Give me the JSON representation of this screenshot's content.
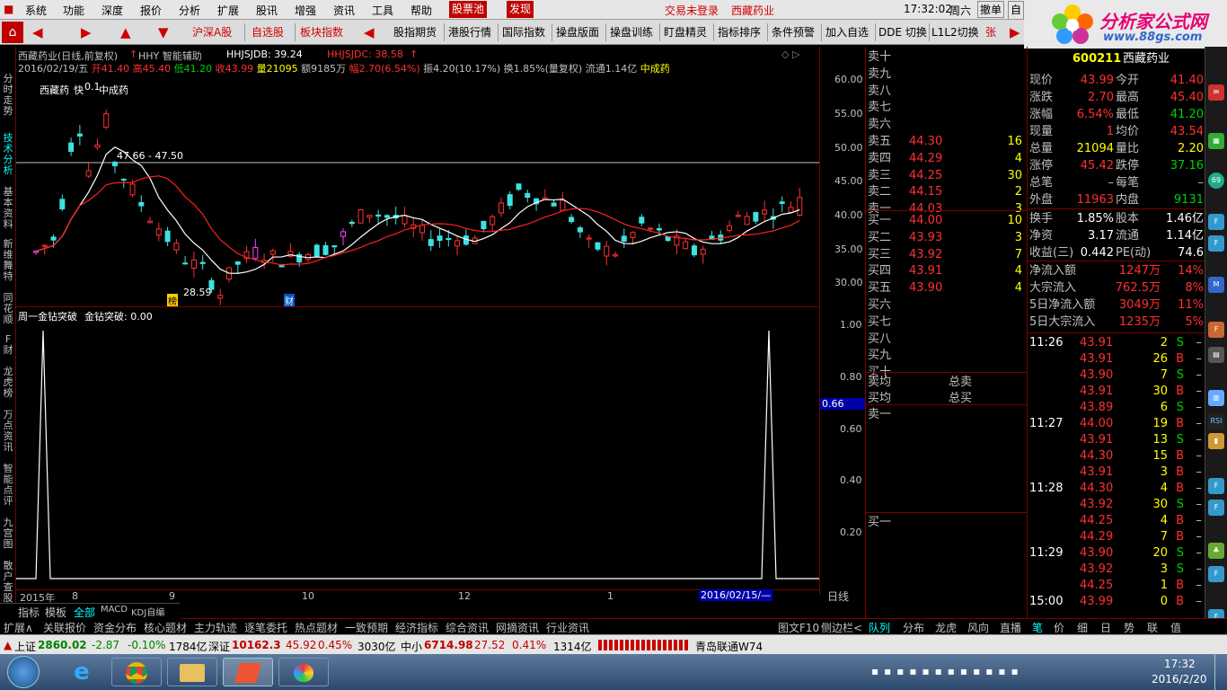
{
  "menu": {
    "items": [
      "系统",
      "功能",
      "深度",
      "报价",
      "分析",
      "扩展",
      "股讯",
      "增强",
      "资讯",
      "工具",
      "帮助"
    ],
    "gupiaochi": "股票池",
    "faxian": "发现",
    "login": "交易未登录",
    "stock": "西藏药业"
  },
  "topright": {
    "time": "17:32:02",
    "weekday": "周六",
    "cancel": "撤单",
    "select": "自选"
  },
  "toolbar": {
    "items": [
      "沪深A股",
      "自选股",
      "板块指数",
      "股指期货",
      "港股行情",
      "国际指数",
      "操盘版面",
      "操盘训练",
      "盯盘精灵",
      "指标排序",
      "条件预警",
      "加入自选",
      "DDE 切换",
      "L1L2切换",
      "张"
    ]
  },
  "logo": {
    "text": "分析家公式网",
    "url": "www.88gs.com"
  },
  "leftbar": {
    "tabs": [
      "分时走势",
      "技术分析",
      "基本资料",
      "新维舞特",
      "同花顺",
      "F财",
      "龙虎榜",
      "万点资讯",
      "智能点评",
      "九宫图",
      "散户查股"
    ]
  },
  "chart": {
    "title": "西藏药业(日线,前复权)",
    "hhy": "HHY 智能辅助",
    "hhjsjdb": "HHJSJDB: 39.24",
    "hhjsjdc": "HHJSJDC: 38.58",
    "date": "2016/02/19/五",
    "open": "开41.40",
    "high": "高45.40",
    "low": "低41.20",
    "close": "收43.99",
    "vol": "量21095",
    "amt": "额9185万",
    "range": "幅2.70(6.54%)",
    "amp": "振4.20(10.17%)",
    "turn": "换1.85%(量复权)",
    "float": "流通1.14亿",
    "concept": "中成药",
    "label_stock": "西藏药",
    "label_kuai": "快",
    "label_val": "0.1",
    "label_zcy": "中成药",
    "range_label": "47.66 - 47.50",
    "low_label": "28.59",
    "bang": "榜",
    "cai": "财",
    "nav_hint": "◇ ▷"
  },
  "price_axis": [
    "60.00",
    "55.00",
    "50.00",
    "45.00",
    "40.00",
    "35.00",
    "30.00"
  ],
  "indicator": {
    "title": "周一金钻突破",
    "value": "金钻突破: 0.00",
    "axis": [
      "1.00",
      "0.80",
      "0.66",
      "0.60",
      "0.40",
      "0.20"
    ]
  },
  "xaxis": {
    "labels": [
      "2015年",
      "8",
      "9",
      "10",
      "12",
      "1"
    ],
    "cursor": "2016/02/15/—",
    "period": "日线"
  },
  "chart_data": {
    "type": "candlestick",
    "title": "西藏药业(日线,前复权)",
    "ylim": [
      28,
      62
    ],
    "last": {
      "date": "2016/02/19",
      "open": 41.4,
      "high": 45.4,
      "low": 41.2,
      "close": 43.99
    },
    "annotations": [
      "47.66 - 47.50",
      "28.59"
    ]
  },
  "book": {
    "sell": [
      [
        "卖十",
        "",
        ""
      ],
      [
        "卖九",
        "",
        ""
      ],
      [
        "卖八",
        "",
        ""
      ],
      [
        "卖七",
        "",
        ""
      ],
      [
        "卖六",
        "",
        ""
      ],
      [
        "卖五",
        "44.30",
        "16"
      ],
      [
        "卖四",
        "44.29",
        "4"
      ],
      [
        "卖三",
        "44.25",
        "30"
      ],
      [
        "卖二",
        "44.15",
        "2"
      ],
      [
        "卖一",
        "44.03",
        "3"
      ]
    ],
    "buy": [
      [
        "买一",
        "44.00",
        "10"
      ],
      [
        "买二",
        "43.93",
        "3"
      ],
      [
        "买三",
        "43.92",
        "7"
      ],
      [
        "买四",
        "43.91",
        "4"
      ],
      [
        "买五",
        "43.90",
        "4"
      ],
      [
        "买六",
        "",
        ""
      ],
      [
        "买七",
        "",
        ""
      ],
      [
        "买八",
        "",
        ""
      ],
      [
        "买九",
        "",
        ""
      ],
      [
        "买十",
        "",
        ""
      ]
    ],
    "sell_avg": "卖均",
    "total_sell": "总卖",
    "buy_avg": "买均",
    "total_buy": "总买",
    "sell1": "卖一",
    "buy1": "买一"
  },
  "quote": {
    "code": "600211",
    "name": "西藏药业",
    "rows": [
      [
        "现价",
        "43.99",
        "今开",
        "41.40"
      ],
      [
        "涨跌",
        "2.70",
        "最高",
        "45.40"
      ],
      [
        "涨幅",
        "6.54%",
        "最低",
        "41.20"
      ],
      [
        "现量",
        "1",
        "均价",
        "43.54"
      ],
      [
        "总量",
        "21094",
        "量比",
        "2.20"
      ],
      [
        "涨停",
        "45.42",
        "跌停",
        "37.16"
      ],
      [
        "总笔",
        "–",
        "每笔",
        "–"
      ],
      [
        "外盘",
        "11963",
        "内盘",
        "9131"
      ],
      [
        "换手",
        "1.85%",
        "股本",
        "1.46亿"
      ],
      [
        "净资",
        "3.17",
        "流通",
        "1.14亿"
      ],
      [
        "收益(三)",
        "0.442",
        "PE(动)",
        "74.6"
      ],
      [
        "净流入额",
        "1247万",
        "",
        "14%"
      ],
      [
        "大宗流入",
        "762.5万",
        "",
        "8%"
      ],
      [
        "5日净流入额",
        "3049万",
        "",
        "11%"
      ],
      [
        "5日大宗流入",
        "1235万",
        "",
        "5%"
      ]
    ]
  },
  "ticks": [
    [
      "11:26",
      "43.91",
      "2",
      "S"
    ],
    [
      "",
      "43.91",
      "26",
      "B"
    ],
    [
      "",
      "43.90",
      "7",
      "S"
    ],
    [
      "",
      "43.91",
      "30",
      "B"
    ],
    [
      "",
      "43.89",
      "6",
      "S"
    ],
    [
      "11:27",
      "44.00",
      "19",
      "B"
    ],
    [
      "",
      "43.91",
      "13",
      "S"
    ],
    [
      "",
      "44.30",
      "15",
      "B"
    ],
    [
      "",
      "43.91",
      "3",
      "B"
    ],
    [
      "11:28",
      "44.30",
      "4",
      "B"
    ],
    [
      "",
      "43.92",
      "30",
      "S"
    ],
    [
      "",
      "44.25",
      "4",
      "B"
    ],
    [
      "",
      "44.29",
      "7",
      "B"
    ],
    [
      "11:29",
      "43.90",
      "20",
      "S"
    ],
    [
      "",
      "43.92",
      "3",
      "S"
    ],
    [
      "",
      "44.25",
      "1",
      "B"
    ],
    [
      "15:00",
      "43.99",
      "0",
      "B"
    ]
  ],
  "bottom": {
    "left": [
      "指标",
      "模板",
      "全部",
      "MACD",
      "KDJ自编"
    ],
    "tabs": [
      "扩展∧",
      "关联报价",
      "资金分布",
      "核心题材",
      "主力轨迹",
      "逐笔委托",
      "热点题材",
      "一致预期",
      "经济指标",
      "综合资讯",
      "网摘资讯",
      "行业资讯"
    ],
    "f10": "图文F10",
    "side": "侧边栏<",
    "rtabs": [
      "队列",
      "分布",
      "龙虎",
      "风向",
      "直播",
      "笔",
      "价",
      "细",
      "日",
      "势",
      "联",
      "值"
    ]
  },
  "status": {
    "sh": "上证",
    "sh_val": "2860.02",
    "sh_chg": "-2.87",
    "sh_pct": "-0.10%",
    "sh_amt": "1784亿",
    "sz": "深证",
    "sz_val": "10162.3",
    "sz_chg": "45.92",
    "sz_pct": "0.45%",
    "sz_amt": "3030亿",
    "zx": "中小",
    "zx_val": "6714.98",
    "zx_chg": "27.52",
    "zx_pct": "0.41%",
    "zx_amt": "1314亿",
    "server": "青岛联通W74"
  },
  "taskbar": {
    "time": "17:32",
    "date": "2016/2/20"
  }
}
